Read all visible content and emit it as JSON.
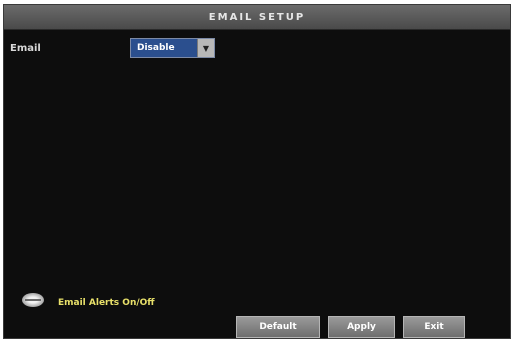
{
  "window": {
    "title": "EMAIL SETUP"
  },
  "form": {
    "email_label": "Email",
    "email_value": "Disable"
  },
  "hint": {
    "icon": "mouse-icon",
    "text": "Email Alerts On/Off"
  },
  "buttons": {
    "default_label": "Default",
    "apply_label": "Apply",
    "exit_label": "Exit"
  }
}
